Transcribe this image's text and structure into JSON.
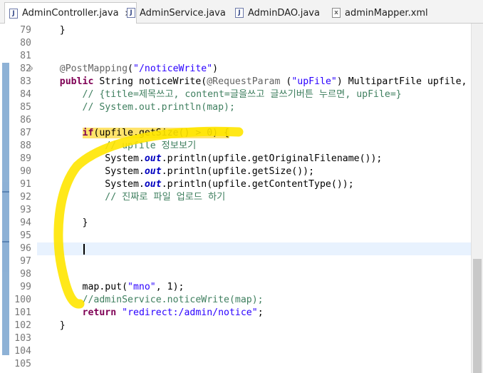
{
  "tabs": [
    {
      "label": "AdminController.java",
      "icon": "java-file-icon",
      "active": true,
      "closable": true
    },
    {
      "label": "AdminService.java",
      "icon": "java-file-icon",
      "active": false
    },
    {
      "label": "AdminDAO.java",
      "icon": "java-file-icon",
      "active": false
    },
    {
      "label": "adminMapper.xml",
      "icon": "xml-file-icon",
      "active": false
    }
  ],
  "close_glyph": "✕",
  "colors": {
    "keyword": "#7f0055",
    "string": "#2a00ff",
    "comment": "#3f7f5f",
    "annotation": "#646464",
    "highlight": "#ffe36b",
    "current_line": "#e8f2fe",
    "pen_stroke": "#ffe600"
  },
  "editor": {
    "current_line": "96",
    "lines": [
      {
        "n": "79",
        "segments": [
          {
            "t": "    }",
            "c": ""
          }
        ]
      },
      {
        "n": "80",
        "segments": []
      },
      {
        "n": "81",
        "segments": []
      },
      {
        "n": "82",
        "fold": "⊖",
        "segments": [
          {
            "t": "    ",
            "c": ""
          },
          {
            "t": "@PostMapping",
            "c": "ann"
          },
          {
            "t": "(",
            "c": ""
          },
          {
            "t": "\"/noticeWrite\"",
            "c": "str"
          },
          {
            "t": ")",
            "c": ""
          }
        ]
      },
      {
        "n": "83",
        "segments": [
          {
            "t": "    ",
            "c": ""
          },
          {
            "t": "public",
            "c": "kw"
          },
          {
            "t": " String noticeWrite(",
            "c": ""
          },
          {
            "t": "@RequestParam",
            "c": "ann"
          },
          {
            "t": " (",
            "c": ""
          },
          {
            "t": "\"upFile\"",
            "c": "str"
          },
          {
            "t": ") MultipartFile upfile,",
            "c": ""
          }
        ]
      },
      {
        "n": "84",
        "segments": [
          {
            "t": "        ",
            "c": ""
          },
          {
            "t": "// {title=제목쓰고, content=글을쓰고 글쓰기버튼 누르면, upFile=}",
            "c": "com"
          }
        ]
      },
      {
        "n": "85",
        "segments": [
          {
            "t": "        ",
            "c": ""
          },
          {
            "t": "// System.out.println(map);",
            "c": "com"
          }
        ]
      },
      {
        "n": "86",
        "segments": []
      },
      {
        "n": "87",
        "segments": [
          {
            "t": "        ",
            "c": ""
          },
          {
            "t": "if",
            "c": "kw hl"
          },
          {
            "t": "(upfile.getSize() > 0) {",
            "c": "hl"
          }
        ]
      },
      {
        "n": "88",
        "segments": [
          {
            "t": "            ",
            "c": ""
          },
          {
            "t": "// upfile 정보보기",
            "c": "com"
          }
        ]
      },
      {
        "n": "89",
        "segments": [
          {
            "t": "            System.",
            "c": ""
          },
          {
            "t": "out",
            "c": "it"
          },
          {
            "t": ".println(upfile.getOriginalFilename());",
            "c": ""
          }
        ]
      },
      {
        "n": "90",
        "segments": [
          {
            "t": "            System.",
            "c": ""
          },
          {
            "t": "out",
            "c": "it"
          },
          {
            "t": ".println(upfile.getSize());",
            "c": ""
          }
        ]
      },
      {
        "n": "91",
        "segments": [
          {
            "t": "            System.",
            "c": ""
          },
          {
            "t": "out",
            "c": "it"
          },
          {
            "t": ".println(upfile.getContentType());",
            "c": ""
          }
        ]
      },
      {
        "n": "92",
        "segments": [
          {
            "t": "            ",
            "c": ""
          },
          {
            "t": "// 진짜로 파일 업로드 하기",
            "c": "com"
          }
        ]
      },
      {
        "n": "93",
        "segments": []
      },
      {
        "n": "94",
        "segments": [
          {
            "t": "        }",
            "c": ""
          }
        ]
      },
      {
        "n": "95",
        "segments": []
      },
      {
        "n": "96",
        "segments": []
      },
      {
        "n": "97",
        "segments": []
      },
      {
        "n": "98",
        "segments": []
      },
      {
        "n": "99",
        "segments": [
          {
            "t": "        map.put(",
            "c": ""
          },
          {
            "t": "\"mno\"",
            "c": "str"
          },
          {
            "t": ", 1);",
            "c": ""
          }
        ]
      },
      {
        "n": "100",
        "segments": [
          {
            "t": "        ",
            "c": ""
          },
          {
            "t": "//adminService.noticeWrite(map);",
            "c": "com"
          }
        ]
      },
      {
        "n": "101",
        "segments": [
          {
            "t": "        ",
            "c": ""
          },
          {
            "t": "return",
            "c": "kw"
          },
          {
            "t": " ",
            "c": ""
          },
          {
            "t": "\"redirect:/admin/notice\"",
            "c": "str"
          },
          {
            "t": ";",
            "c": ""
          }
        ]
      },
      {
        "n": "102",
        "segments": [
          {
            "t": "    }",
            "c": ""
          }
        ]
      },
      {
        "n": "103",
        "segments": []
      },
      {
        "n": "104",
        "segments": []
      },
      {
        "n": "105",
        "segments": []
      }
    ]
  }
}
